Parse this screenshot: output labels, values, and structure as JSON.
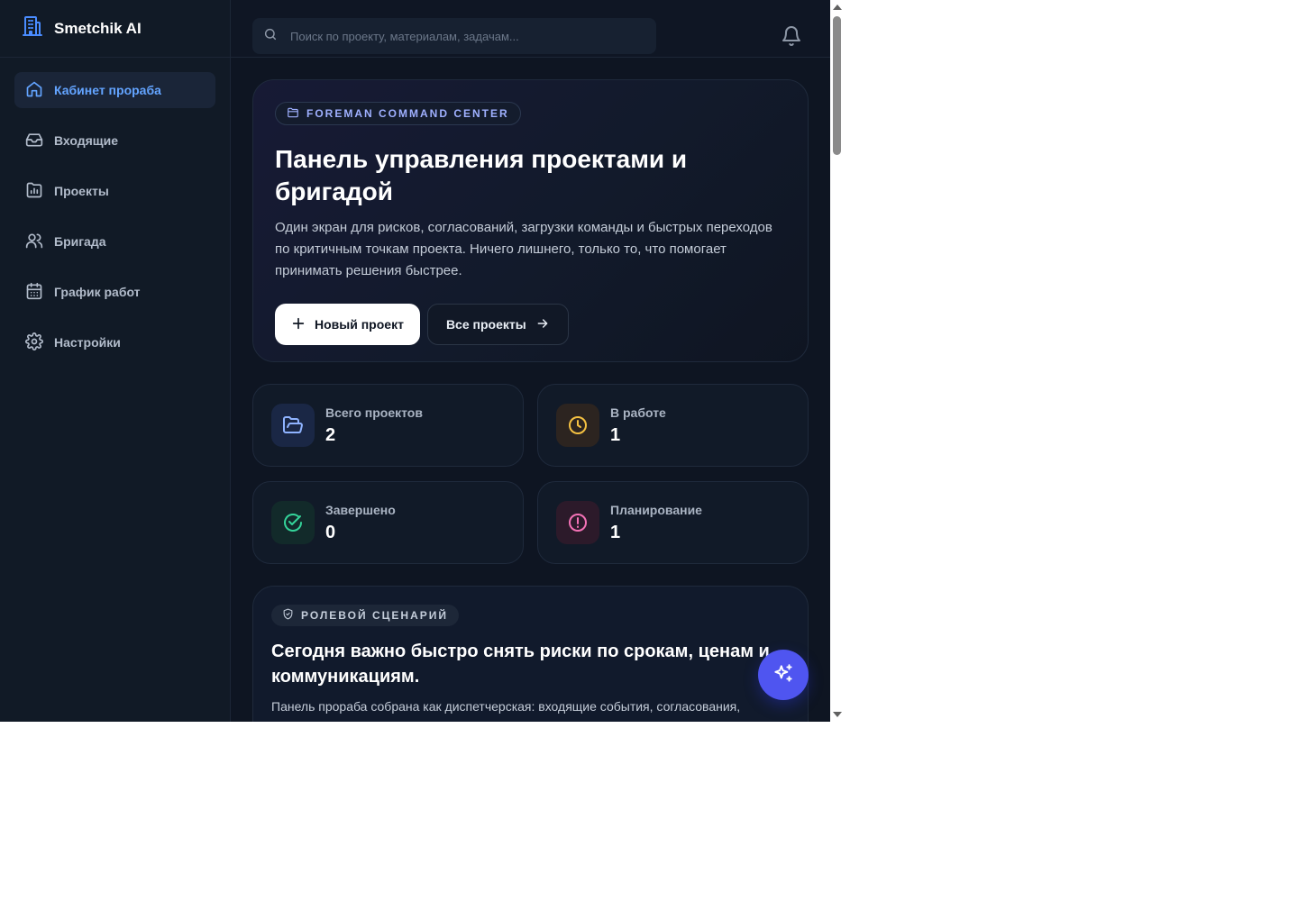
{
  "app": {
    "name": "Smetchik AI"
  },
  "sidebar": {
    "items": [
      {
        "label": "Кабинет прораба",
        "icon": "home-icon",
        "active": true
      },
      {
        "label": "Входящие",
        "icon": "inbox-icon"
      },
      {
        "label": "Проекты",
        "icon": "folder-chart-icon"
      },
      {
        "label": "Бригада",
        "icon": "users-icon"
      },
      {
        "label": "График работ",
        "icon": "calendar-icon"
      },
      {
        "label": "Настройки",
        "icon": "gear-icon"
      }
    ]
  },
  "search": {
    "placeholder": "Поиск по проекту, материалам, задачам..."
  },
  "hero": {
    "badge": "FOREMAN COMMAND CENTER",
    "title": "Панель управления проектами и бригадой",
    "description": "Один экран для рисков, согласований, загрузки команды и быстрых переходов по критичным точкам проекта. Ничего лишнего, только то, что помогает принимать решения быстрее.",
    "primary_button": "Новый проект",
    "secondary_button": "Все проекты"
  },
  "stats": [
    {
      "label": "Всего проектов",
      "value": "2",
      "icon": "folder-open-icon",
      "color": "#8fb3ff",
      "bg": "#1a2745"
    },
    {
      "label": "В работе",
      "value": "1",
      "icon": "clock-icon",
      "color": "#f5c142",
      "bg": "#2c2420"
    },
    {
      "label": "Завершено",
      "value": "0",
      "icon": "check-circle-icon",
      "color": "#34d399",
      "bg": "#122a2a"
    },
    {
      "label": "Планирование",
      "value": "1",
      "icon": "alert-circle-icon",
      "color": "#f472b6",
      "bg": "#2c1a2a"
    }
  ],
  "scenario": {
    "badge": "РОЛЕВОЙ СЦЕНАРИЙ",
    "title": "Сегодня важно быстро снять риски по срокам, ценам и коммуникациям.",
    "description": "Панель прораба собрана как диспетчерская: входящие события, согласования,"
  },
  "colors": {
    "accent": "#63a4ff",
    "fab": "#4f55f0",
    "background": "#0e1522"
  }
}
